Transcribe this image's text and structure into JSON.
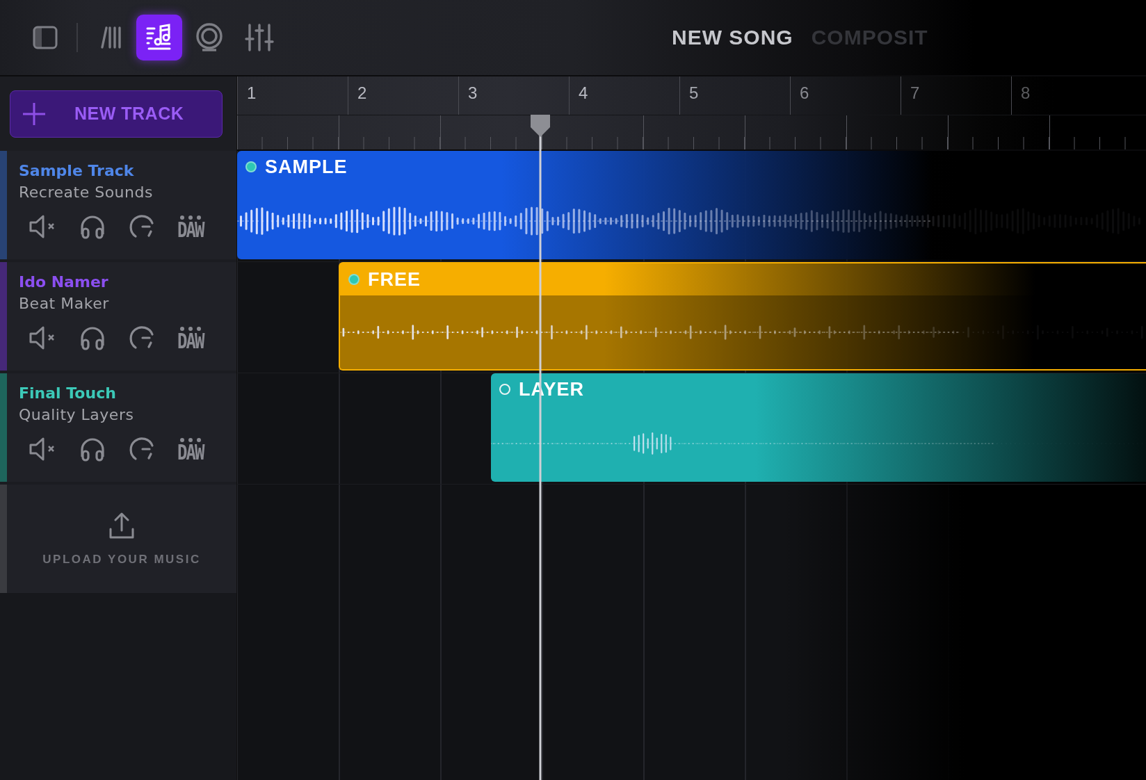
{
  "toolbar": {
    "tools": [
      {
        "kind": "panel",
        "selected": false
      },
      {
        "kind": "bars",
        "selected": false
      },
      {
        "kind": "notes",
        "selected": true
      },
      {
        "kind": "ring",
        "selected": false
      },
      {
        "kind": "mixer",
        "selected": false
      }
    ],
    "title": "NEW SONG",
    "subtitle": "COMPOSIT"
  },
  "new_track_button": {
    "label": "NEW TRACK"
  },
  "tracks": [
    {
      "name": "Sample Track",
      "description": "Recreate Sounds",
      "color": "#4f86e8",
      "menu_label": "DAW"
    },
    {
      "name": "Ido Namer",
      "description": "Beat Maker",
      "color": "#8b4ff0",
      "menu_label": "DAW"
    },
    {
      "name": "Final Touch",
      "description": "Quality Layers",
      "color": "#3cc9b8",
      "menu_label": "DAW"
    }
  ],
  "upload": {
    "label": "UPLOAD YOUR MUSIC"
  },
  "ruler": {
    "bars": [
      "1",
      "2",
      "3",
      "4",
      "5",
      "6",
      "7",
      "8"
    ]
  },
  "clips": [
    {
      "label": "SAMPLE",
      "color": "#1558e0",
      "kind": "plain",
      "active": true
    },
    {
      "label": "FREE",
      "color": "#f6ae00",
      "kind": "header",
      "active": true
    },
    {
      "label": "LAYER",
      "color": "#1fb0b0",
      "kind": "plain",
      "active": false
    }
  ]
}
